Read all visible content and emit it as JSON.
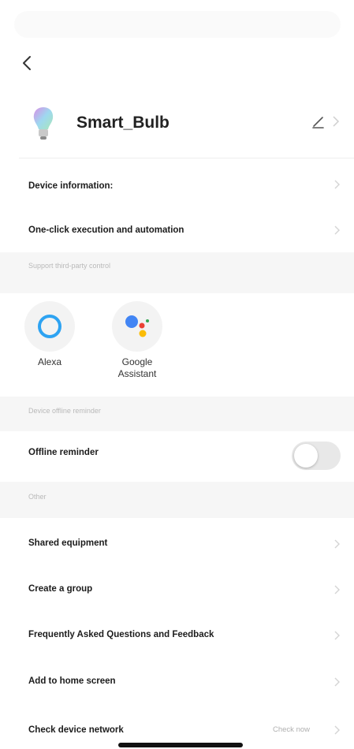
{
  "device": {
    "name": "Smart_Bulb"
  },
  "menu": {
    "device_information": "Device information:",
    "one_click": "One-click execution and automation"
  },
  "third_party": {
    "section_label": "Support third-party control",
    "services": [
      {
        "label": "Alexa",
        "icon": "alexa-icon"
      },
      {
        "label": "Google\nAssistant",
        "icon": "google-assistant-icon"
      }
    ]
  },
  "offline": {
    "section_label": "Device offline reminder",
    "label": "Offline reminder",
    "enabled": false
  },
  "other": {
    "section_label": "Other",
    "items": [
      {
        "label": "Shared equipment"
      },
      {
        "label": "Create a group"
      },
      {
        "label": "Frequently Asked Questions and Feedback"
      },
      {
        "label": "Add to home screen"
      },
      {
        "label": "Check device network",
        "value": "Check now"
      }
    ]
  },
  "icons": {
    "back": "chevron-left-icon",
    "edit": "pencil-icon",
    "chevron": "chevron-right-icon"
  },
  "colors": {
    "alexa_ring": "#2ea3f2",
    "google_blue": "#4285F4",
    "google_red": "#EA4335",
    "google_yellow": "#FBBC05",
    "google_green": "#34A853"
  }
}
